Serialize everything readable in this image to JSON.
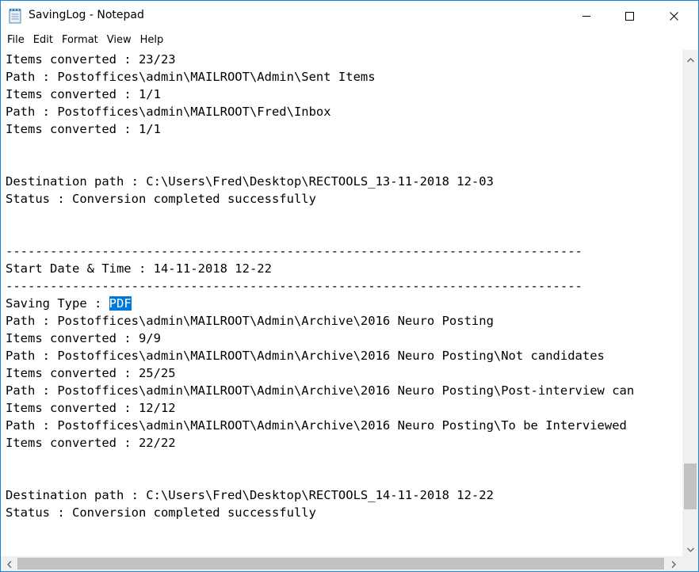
{
  "window": {
    "title": "SavingLog - Notepad",
    "accent_color": "#1883d7",
    "icons": {
      "app": "notepad-icon",
      "minimize": "minimize-icon",
      "maximize": "maximize-icon",
      "close": "close-icon"
    }
  },
  "menu": {
    "items": [
      "File",
      "Edit",
      "Format",
      "View",
      "Help"
    ]
  },
  "document": {
    "selection_color": "#0078d7",
    "lines": [
      "Items converted : 23/23",
      "Path : Postoffices\\admin\\MAILROOT\\Admin\\Sent Items",
      "Items converted : 1/1",
      "Path : Postoffices\\admin\\MAILROOT\\Fred\\Inbox",
      "Items converted : 1/1",
      "",
      "",
      "Destination path : C:\\Users\\Fred\\Desktop\\RECTOOLS_13-11-2018 12-03",
      "Status : Conversion completed successfully",
      "",
      "",
      "------------------------------------------------------------------------------",
      "Start Date & Time : 14-11-2018 12-22",
      "------------------------------------------------------------------------------",
      "Saving Type : ",
      "Path : Postoffices\\admin\\MAILROOT\\Admin\\Archive\\2016 Neuro Posting",
      "Items converted : 9/9",
      "Path : Postoffices\\admin\\MAILROOT\\Admin\\Archive\\2016 Neuro Posting\\Not candidates",
      "Items converted : 25/25",
      "Path : Postoffices\\admin\\MAILROOT\\Admin\\Archive\\2016 Neuro Posting\\Post-interview can",
      "Items converted : 12/12",
      "Path : Postoffices\\admin\\MAILROOT\\Admin\\Archive\\2016 Neuro Posting\\To be Interviewed",
      "Items converted : 22/22",
      "",
      "",
      "Destination path : C:\\Users\\Fred\\Desktop\\RECTOOLS_14-11-2018 12-22",
      "Status : Conversion completed successfully"
    ],
    "selected_line_index": 14,
    "selected_text": "PDF"
  },
  "scrollbars": {
    "vertical_position": 0.93,
    "icons": {
      "up": "scroll-up-arrow-icon",
      "down": "scroll-down-arrow-icon",
      "left": "scroll-left-arrow-icon",
      "right": "scroll-right-arrow-icon"
    }
  }
}
